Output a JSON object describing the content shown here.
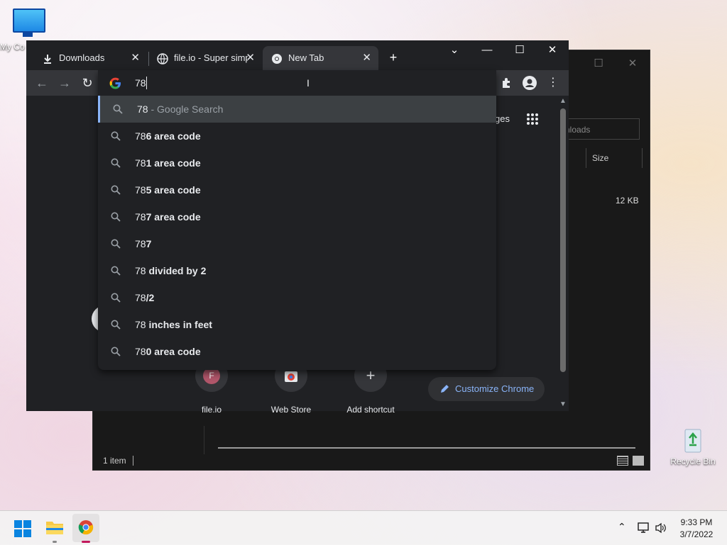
{
  "desktop": {
    "icons": [
      {
        "label": "My Co"
      },
      {
        "label": "Recycle Bin"
      }
    ]
  },
  "explorer": {
    "search_placeholder": "nloads",
    "column_size": "Size",
    "file_size": "12 KB",
    "status": "1 item"
  },
  "chrome": {
    "tabs": [
      {
        "title": "Downloads"
      },
      {
        "title": "file.io - Super simp"
      },
      {
        "title": "New Tab"
      }
    ],
    "omnibox": {
      "value": "78",
      "suggestions": [
        {
          "prefix": "78",
          "suffix": "",
          "hint": " - Google Search"
        },
        {
          "prefix": "78",
          "suffix": "6 area code",
          "hint": ""
        },
        {
          "prefix": "78",
          "suffix": "1 area code",
          "hint": ""
        },
        {
          "prefix": "78",
          "suffix": "5 area code",
          "hint": ""
        },
        {
          "prefix": "78",
          "suffix": "7 area code",
          "hint": ""
        },
        {
          "prefix": "78",
          "suffix": "7",
          "hint": ""
        },
        {
          "prefix": "78",
          "suffix": " divided by 2",
          "hint": ""
        },
        {
          "prefix": "78",
          "suffix": "/2",
          "hint": ""
        },
        {
          "prefix": "78",
          "suffix": " inches in feet",
          "hint": ""
        },
        {
          "prefix": "78",
          "suffix": "0 area code",
          "hint": ""
        }
      ]
    },
    "ntp": {
      "images_link": "ges",
      "shortcuts": [
        {
          "label": "file.io",
          "initial": "F"
        },
        {
          "label": "Web Store",
          "initial": ""
        },
        {
          "label": "Add shortcut",
          "initial": "+"
        }
      ],
      "customize_label": "Customize Chrome"
    }
  },
  "taskbar": {
    "time": "9:33 PM",
    "date": "3/7/2022"
  },
  "colors": {
    "chrome_bg": "#202124",
    "chrome_toolbar": "#35363a",
    "accent_blue": "#8ab4f8",
    "taskbar": "#f3f3f3"
  }
}
